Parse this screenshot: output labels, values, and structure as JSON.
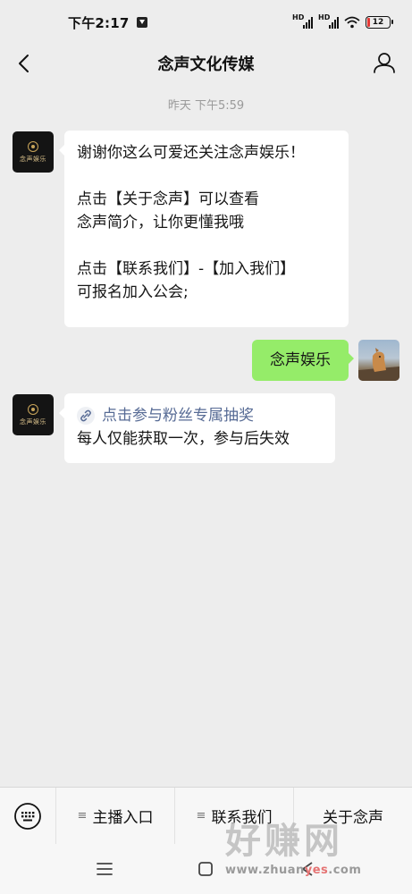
{
  "status_bar": {
    "time": "下午2:17",
    "signal1_label": "HD",
    "signal2_label": "HD",
    "battery": "12"
  },
  "nav": {
    "title": "念声文化传媒"
  },
  "chat": {
    "timestamp": "昨天 下午5:59",
    "bot_avatar_text": "念声娱乐",
    "message1": {
      "lines": [
        "谢谢你这么可爱还关注念声娱乐！",
        "",
        "点击【关于念声】可以查看",
        "念声简介，让你更懂我哦",
        "",
        "点击【联系我们】-【加入我们】",
        "可报名加入公会;"
      ]
    },
    "message2": {
      "text": "念声娱乐"
    },
    "message3": {
      "link_text": "点击参与粉丝专属抽奖",
      "text": "每人仅能获取一次，参与后失效"
    }
  },
  "menu": {
    "items": [
      {
        "label": "主播入口"
      },
      {
        "label": "联系我们"
      },
      {
        "label": "关于念声"
      }
    ]
  },
  "watermark": {
    "big": "好赚网",
    "small_prefix": "www.zhuan",
    "small_accent": "yes",
    "small_suffix": ".com"
  },
  "colors": {
    "background": "#ededed",
    "outgoing_bubble": "#95ec69",
    "link": "#576b95"
  }
}
